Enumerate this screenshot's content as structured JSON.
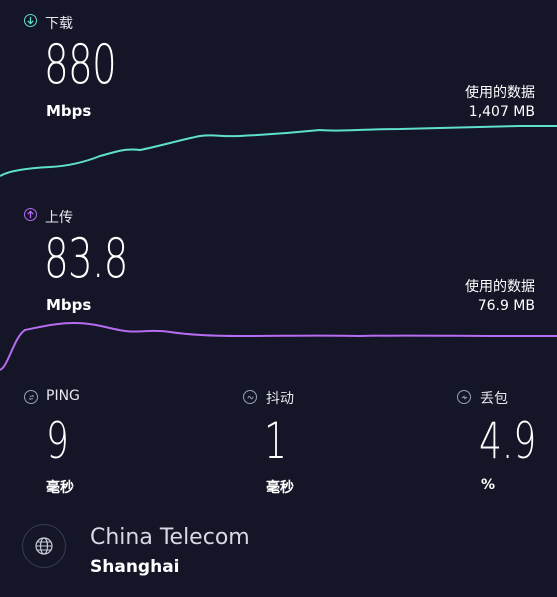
{
  "download": {
    "label": "下载",
    "value": "880",
    "unit": "Mbps",
    "used_label": "使用的数据",
    "used_value": "1,407 MB",
    "color": "#5fe0cc",
    "icon": "arrow-down-circle-icon"
  },
  "upload": {
    "label": "上传",
    "value": "83.8",
    "unit": "Mbps",
    "used_label": "使用的数据",
    "used_value": "76.9 MB",
    "color": "#b56cf0",
    "icon": "arrow-up-circle-icon"
  },
  "metrics": {
    "ping": {
      "label": "PING",
      "value": "9",
      "unit": "毫秒",
      "icon": "ping-icon"
    },
    "jitter": {
      "label": "抖动",
      "value": "1",
      "unit": "毫秒",
      "icon": "jitter-icon"
    },
    "loss": {
      "label": "丢包",
      "value": "4.9",
      "unit": "%",
      "icon": "packet-loss-icon"
    }
  },
  "server": {
    "isp": "China Telecom",
    "city": "Shanghai",
    "icon": "globe-icon"
  },
  "colors": {
    "background": "#141526",
    "download": "#5fe0cc",
    "upload": "#b56cf0"
  }
}
